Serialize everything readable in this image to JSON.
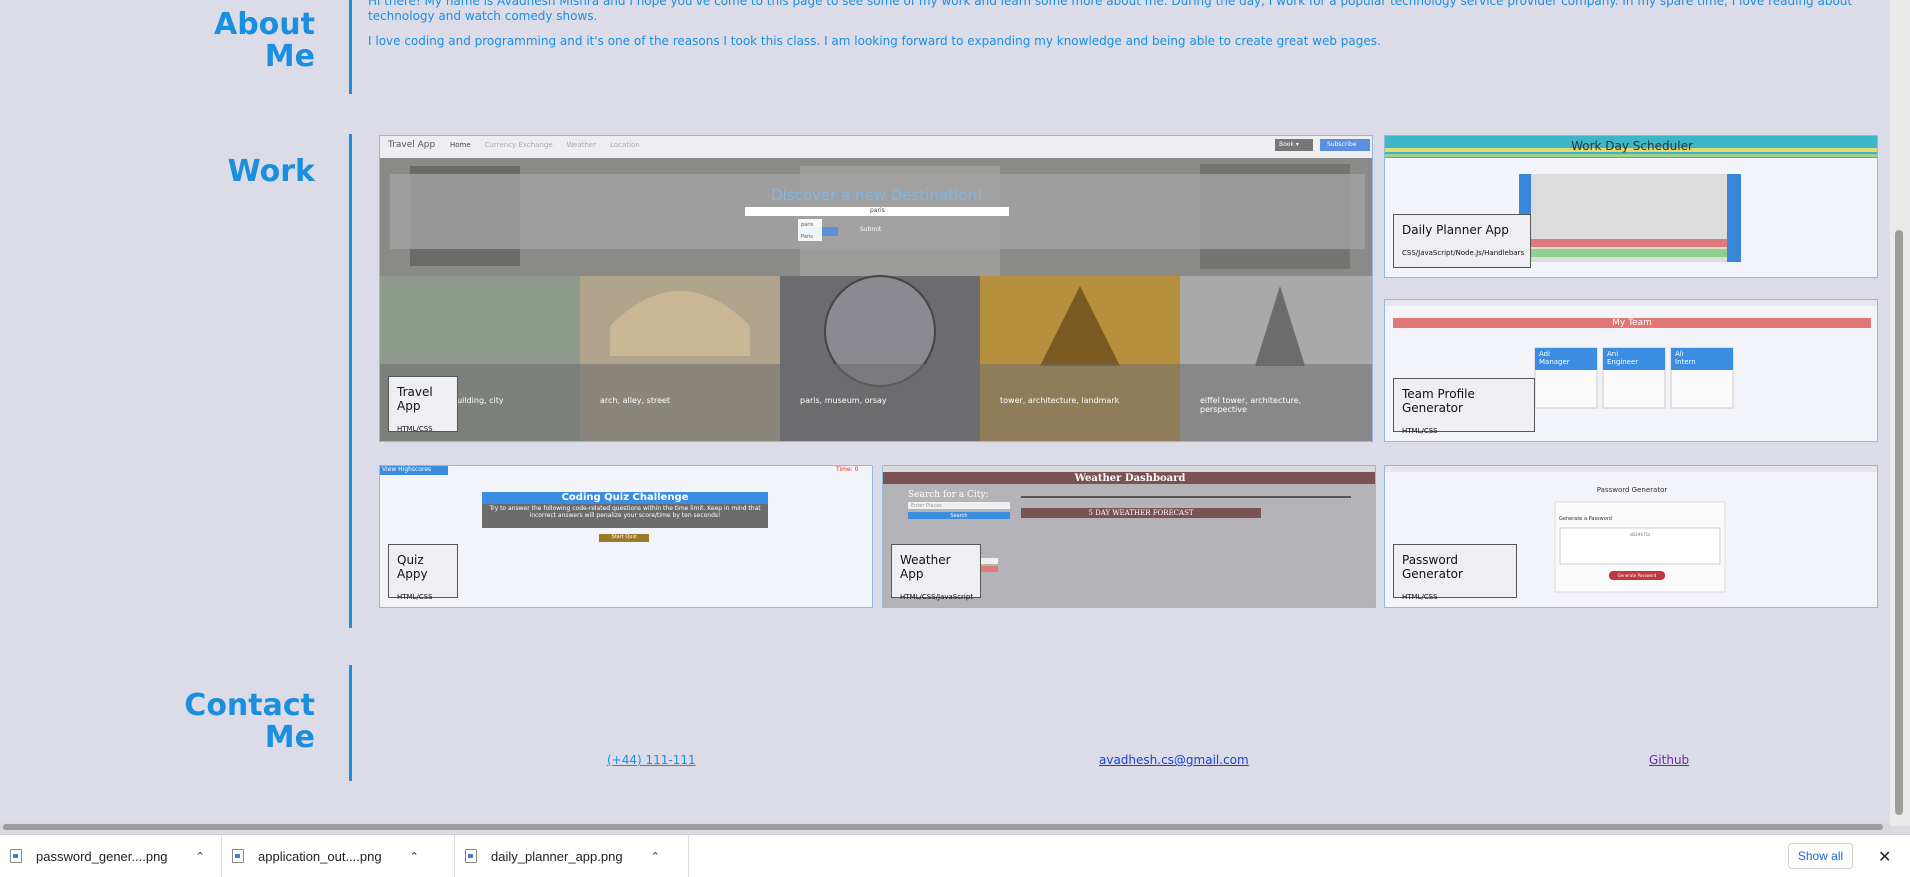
{
  "about": {
    "title_line1": "About",
    "title_line2": "Me",
    "paragraph1": "Hi there! My name is Avadhesh Mishra and I hope you've come to this page to see some of my work and learn some more about me. During the day, I work for a popular technology service provider company. In my spare time, I love reading about technology and watch comedy shows.",
    "paragraph2": "I love coding and programming and it's one of the reasons I took this class. I am looking forward to expanding my knowledge and being able to create great web pages."
  },
  "work": {
    "title": "Work",
    "projects": [
      {
        "title": "Travel App",
        "tech": "HTML/CSS",
        "screen": {
          "brand": "Travel App",
          "nav": [
            "Home",
            "Currency Exchange",
            "Weather",
            "Location"
          ],
          "btn_book": "Book ▾",
          "btn_subscribe": "Subscribe",
          "hero_title": "Discover a new Destination!",
          "search_value": "paris",
          "suggestions": [
            "paris",
            "Paris"
          ],
          "submit": "Submit",
          "photo_tags": [
            "building, city",
            "arch, alley, street",
            "paris, museum, orsay",
            "tower, architecture, landmark",
            "eiffel tower, architecture, perspective"
          ]
        }
      },
      {
        "title": "Daily Planner App",
        "tech": "CSS/JavaScript/Node.Js/Handlebars",
        "screen": {
          "heading": "Work Day Scheduler"
        }
      },
      {
        "title": "Team Profile Generator",
        "tech": "HTML/CSS",
        "screen": {
          "heading": "My Team",
          "members": [
            {
              "name": "Adi",
              "role": "Manager"
            },
            {
              "name": "Ani",
              "role": "Engineer"
            },
            {
              "name": "Ali",
              "role": "Intern"
            }
          ]
        }
      },
      {
        "title": "Quiz Appy",
        "tech": "HTML/CSS",
        "screen": {
          "highscores": "View Highscores",
          "timer": "Time: 0",
          "heading": "Coding Quiz Challenge",
          "body": "Try to answer the following code-related questions within the time limit. Keep in mind that incorrect answers will penalize your score/time by ten seconds!",
          "start": "Start Quiz"
        }
      },
      {
        "title": "Weather App",
        "tech": "HTML/CSS/JavaScript",
        "screen": {
          "heading": "Weather Dashboard",
          "search_label": "Search for a City:",
          "search_placeholder": "Enter Places",
          "search_btn": "Search",
          "forecast": "5 DAY WEATHER FORECAST"
        }
      },
      {
        "title": "Password Generator",
        "tech": "HTML/CSS",
        "screen": {
          "heading": "Password Generator",
          "sub": "Generate a Password",
          "pw": "nB3#kT1z",
          "btn": "Generate Password"
        }
      }
    ]
  },
  "contact": {
    "title_line1": "Contact",
    "title_line2": "Me",
    "phone": "(+44) 111-111",
    "email": "avadhesh.cs@gmail.com",
    "github": "Github"
  },
  "downloads": {
    "items": [
      "password_gener....png",
      "application_out....png",
      "daily_planner_app.png"
    ],
    "show_all": "Show all"
  },
  "colors": {
    "accent": "#1a8fe0",
    "background": "#dcdce9"
  }
}
